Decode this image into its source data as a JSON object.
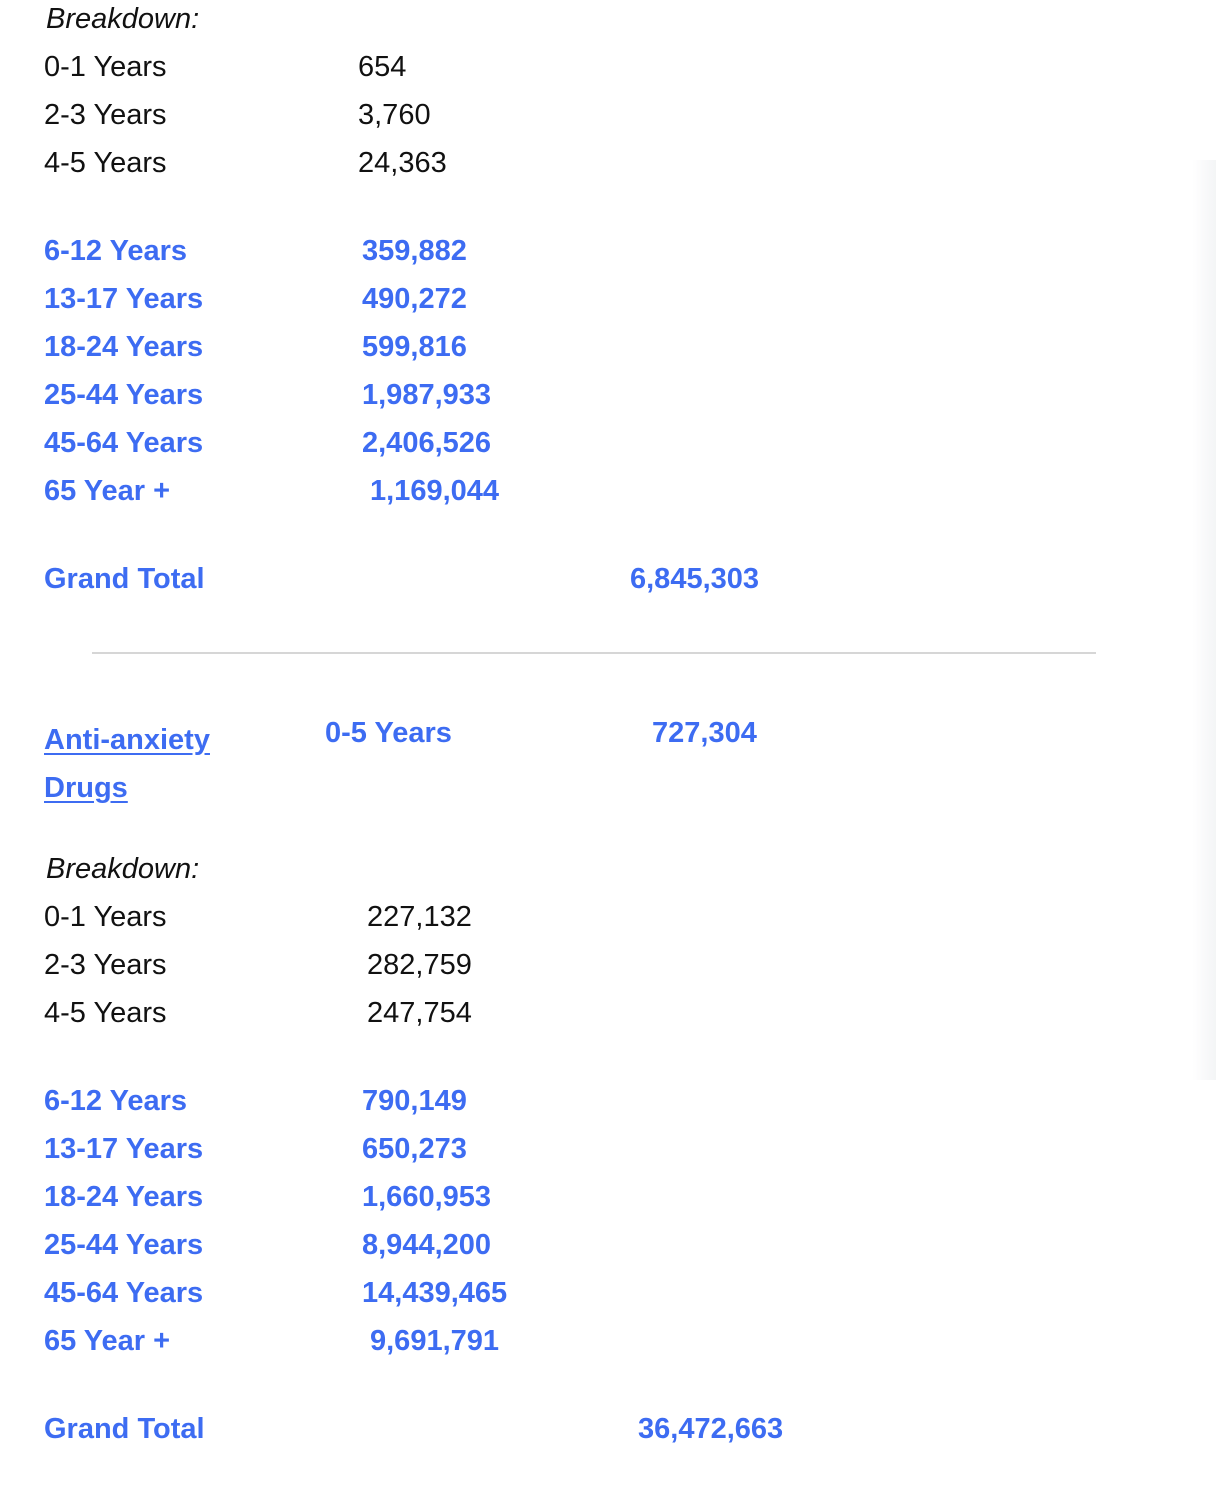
{
  "section1": {
    "breakdown_label": "Breakdown:",
    "plain_rows": [
      {
        "label": "0-1 Years",
        "value": "654"
      },
      {
        "label": "2-3 Years",
        "value": "3,760"
      },
      {
        "label": "4-5 Years",
        "value": "24,363"
      }
    ],
    "bold_rows": [
      {
        "label": "6-12 Years",
        "value": "359,882"
      },
      {
        "label": "13-17 Years",
        "value": "490,272"
      },
      {
        "label": "18-24 Years",
        "value": "599,816"
      },
      {
        "label": "25-44 Years",
        "value": "1,987,933"
      },
      {
        "label": "45-64 Years",
        "value": "2,406,526"
      },
      {
        "label": "65 Year +",
        "value": "1,169,044"
      }
    ],
    "grand_total_label": "Grand Total",
    "grand_total_value": "6,845,303"
  },
  "section2": {
    "drug_link": "Anti-anxiety Drugs",
    "drug_link_line1": "Anti-anxiety",
    "drug_link_line2": "Drugs",
    "age_group": "0-5 Years",
    "age_group_value": "727,304",
    "breakdown_label": "Breakdown:",
    "plain_rows": [
      {
        "label": "0-1 Years",
        "value": "227,132"
      },
      {
        "label": "2-3 Years",
        "value": "282,759"
      },
      {
        "label": "4-5 Years",
        "value": "247,754"
      }
    ],
    "bold_rows": [
      {
        "label": "6-12 Years",
        "value": "790,149"
      },
      {
        "label": "13-17 Years",
        "value": "650,273"
      },
      {
        "label": "18-24 Years",
        "value": "1,660,953"
      },
      {
        "label": "25-44 Years",
        "value": "8,944,200"
      },
      {
        "label": "45-64 Years",
        "value": "14,439,465"
      },
      {
        "label": "65 Year +",
        "value": "9,691,791"
      }
    ],
    "grand_total_label": "Grand Total",
    "grand_total_value": "36,472,663"
  },
  "colors": {
    "accent": "#3d6cf2",
    "text": "#111111",
    "divider": "#d6d6d6"
  }
}
